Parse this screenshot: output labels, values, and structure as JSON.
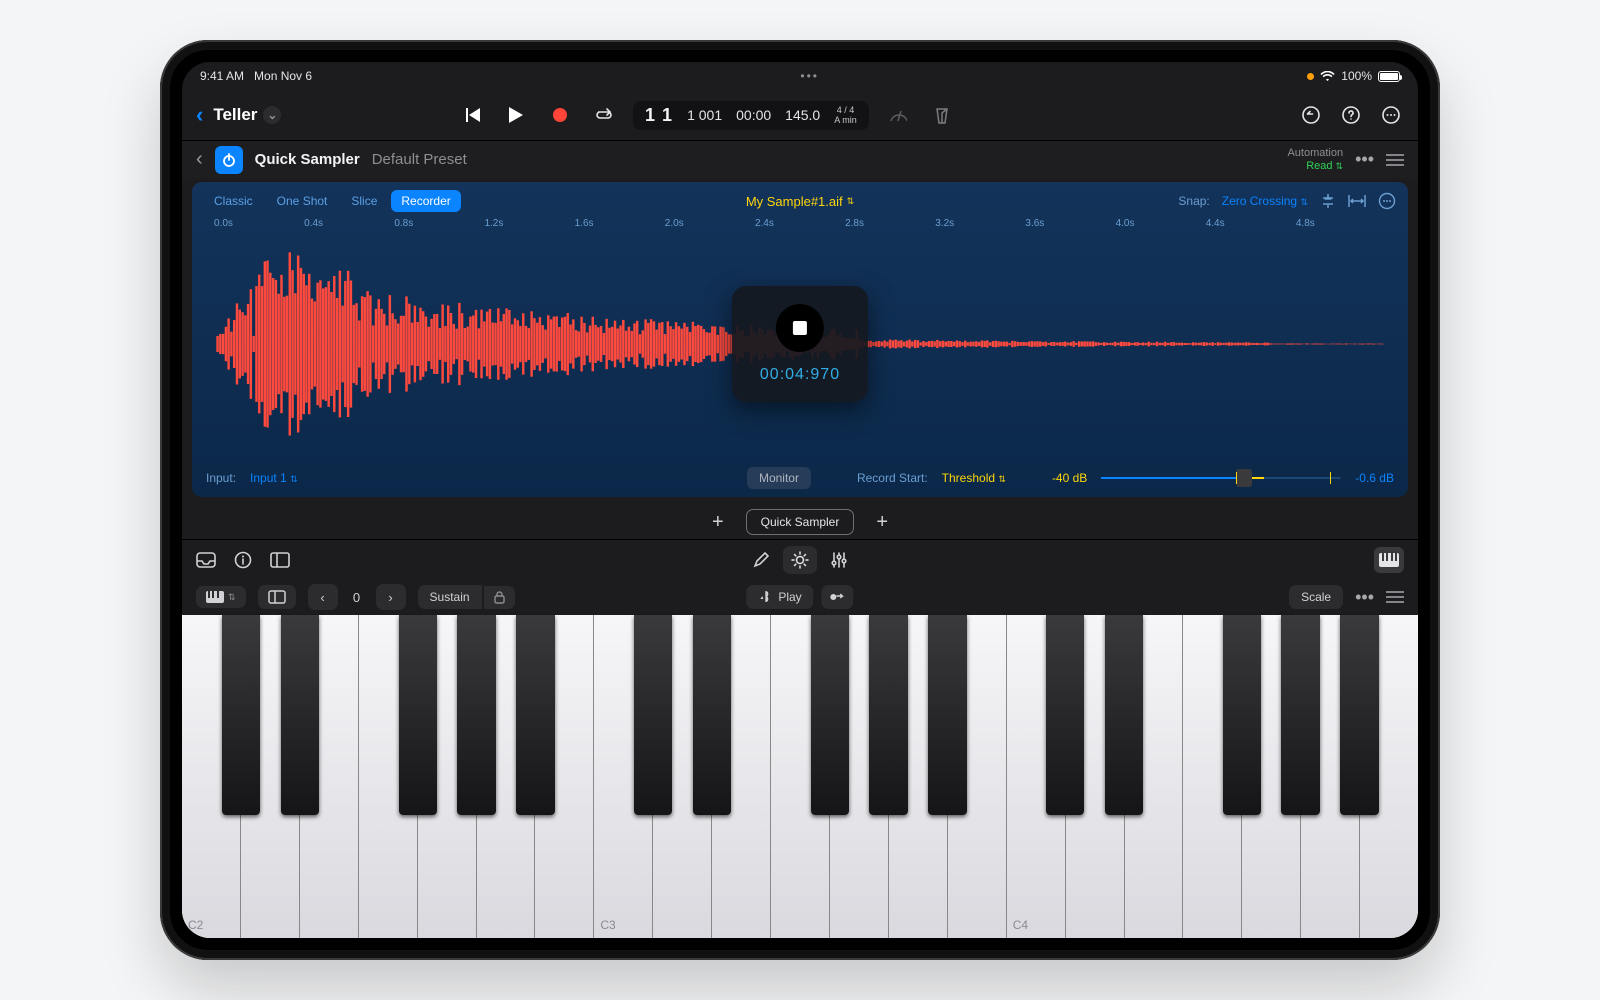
{
  "status": {
    "time": "9:41 AM",
    "date": "Mon Nov 6",
    "battery": "100%"
  },
  "project": {
    "name": "Teller"
  },
  "transport": {
    "bars": "1 1",
    "beats": "1 001",
    "time": "00:00",
    "tempo": "145.0",
    "sig_top": "4 / 4",
    "sig_bottom": "A min"
  },
  "plugin": {
    "name": "Quick Sampler",
    "preset": "Default Preset",
    "automation_label": "Automation",
    "automation_mode": "Read"
  },
  "sampler": {
    "modes": {
      "classic": "Classic",
      "oneshot": "One Shot",
      "slice": "Slice",
      "recorder": "Recorder"
    },
    "sample_name": "My Sample#1.aif",
    "snap_label": "Snap:",
    "snap_value": "Zero Crossing",
    "ruler": [
      "0.0s",
      "0.4s",
      "0.8s",
      "1.2s",
      "1.6s",
      "2.0s",
      "2.4s",
      "2.8s",
      "3.2s",
      "3.6s",
      "4.0s",
      "4.4s",
      "4.8s"
    ],
    "rec_time": "00:04:970",
    "input_label": "Input:",
    "input_value": "Input 1",
    "monitor": "Monitor",
    "recstart_label": "Record Start:",
    "recstart_value": "Threshold",
    "db_left": "-40 dB",
    "db_right": "-0.6 dB"
  },
  "tabs": {
    "quick_sampler": "Quick Sampler"
  },
  "keyboard": {
    "octave": "0",
    "sustain": "Sustain",
    "play": "Play",
    "scale": "Scale",
    "note_labels": {
      "c2": "C2",
      "c3": "C3",
      "c4": "C4"
    }
  }
}
